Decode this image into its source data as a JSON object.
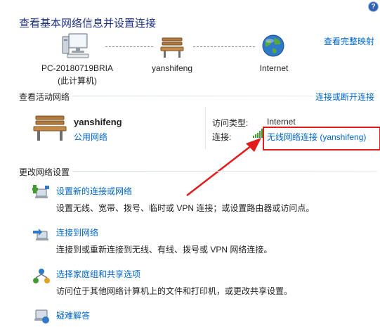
{
  "header": {
    "title": "查看基本网络信息并设置连接",
    "full_map_link": "查看完整映射"
  },
  "network_map": {
    "computer": {
      "line1": "PC-20180719BRIA",
      "line2": "(此计算机)"
    },
    "network": {
      "name": "yanshifeng"
    },
    "internet": {
      "name": "Internet"
    }
  },
  "active_networks": {
    "section_title": "查看活动网络",
    "connect_link": "连接或断开连接",
    "network_name": "yanshifeng",
    "network_type": "公用网络",
    "access_type_label": "访问类型:",
    "access_type_value": "Internet",
    "connection_label": "连接:",
    "connection_value": "无线网络连接 (yanshifeng)"
  },
  "change_settings": {
    "section_title": "更改网络设置",
    "tasks": [
      {
        "link": "设置新的连接或网络",
        "desc": "设置无线、宽带、拨号、临时或 VPN 连接；或设置路由器或访问点。"
      },
      {
        "link": "连接到网络",
        "desc": "连接到或重新连接到无线、有线、拨号或 VPN 网络连接。"
      },
      {
        "link": "选择家庭组和共享选项",
        "desc": "访问位于其他网络计算机上的文件和打印机，或更改共享设置。"
      },
      {
        "link": "疑难解答"
      }
    ]
  },
  "colors": {
    "link": "#0066cc",
    "title": "#1e3287",
    "annotation": "#e21b1b"
  }
}
